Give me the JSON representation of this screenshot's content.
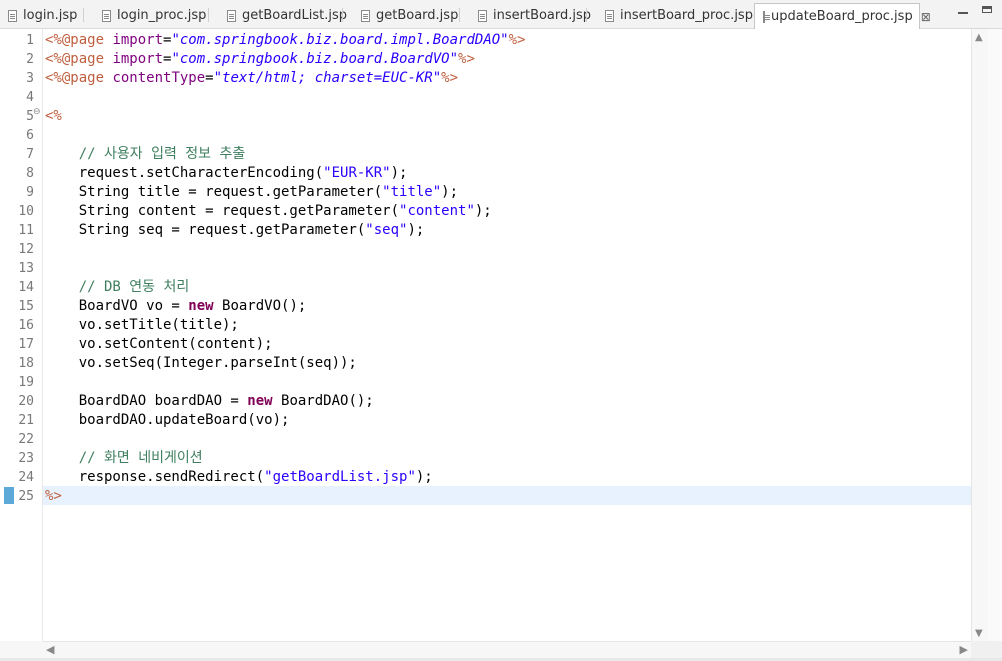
{
  "tabs": [
    {
      "label": "login.jsp",
      "active": false
    },
    {
      "label": "login_proc.jsp",
      "active": false
    },
    {
      "label": "getBoardList.jsp",
      "active": false
    },
    {
      "label": "getBoard.jsp",
      "active": false
    },
    {
      "label": "insertBoard.jsp",
      "active": false
    },
    {
      "label": "insertBoard_proc.jsp",
      "active": false
    },
    {
      "label": "updateBoard_proc.jsp",
      "active": true
    }
  ],
  "active_tab_close": "⊠",
  "line_numbers": [
    "1",
    "2",
    "3",
    "4",
    "5",
    "6",
    "7",
    "8",
    "9",
    "10",
    "11",
    "12",
    "13",
    "14",
    "15",
    "16",
    "17",
    "18",
    "19",
    "20",
    "21",
    "22",
    "23",
    "24",
    "25"
  ],
  "fold_marker": "⊖",
  "code": {
    "l1": {
      "open": "<%@page ",
      "attr": "import",
      "eq": "=",
      "val": "\"com.springbook.biz.board.impl.BoardDAO\"",
      "close": "%>"
    },
    "l2": {
      "open": "<%@page ",
      "attr": "import",
      "eq": "=",
      "val": "\"com.springbook.biz.board.BoardVO\"",
      "close": "%>"
    },
    "l3": {
      "open": "<%@page ",
      "attr": "contentType",
      "eq": "=",
      "val": "\"text/html; charset=EUC-KR\"",
      "close": "%>"
    },
    "l5": "<%",
    "l7": "    // 사용자 입력 정보 추출",
    "l8": {
      "pre": "    request.setCharacterEncoding(",
      "str": "\"EUR-KR\"",
      "post": ");"
    },
    "l9": {
      "pre": "    String title = request.getParameter(",
      "str": "\"title\"",
      "post": ");"
    },
    "l10": {
      "pre": "    String content = request.getParameter(",
      "str": "\"content\"",
      "post": ");"
    },
    "l11": {
      "pre": "    String seq = request.getParameter(",
      "str": "\"seq\"",
      "post": ");"
    },
    "l14": "    // DB 연동 처리",
    "l15": {
      "pre": "    BoardVO vo = ",
      "kw": "new",
      "post": " BoardVO();"
    },
    "l16": "    vo.setTitle(title);",
    "l17": "    vo.setContent(content);",
    "l18": "    vo.setSeq(Integer.parseInt(seq));",
    "l20": {
      "pre": "    BoardDAO boardDAO = ",
      "kw": "new",
      "post": " BoardDAO();"
    },
    "l21": "    boardDAO.updateBoard(vo);",
    "l23": "    // 화면 네비게이션",
    "l24": {
      "pre": "    response.sendRedirect(",
      "str": "\"getBoardList.jsp\"",
      "post": ");"
    },
    "l25": "%>"
  }
}
